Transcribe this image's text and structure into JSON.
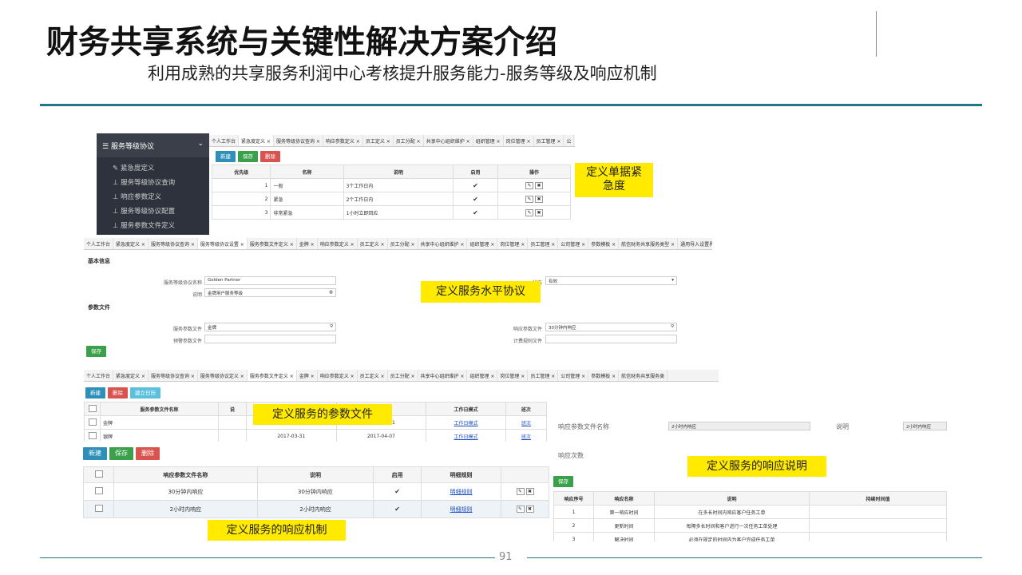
{
  "slide": {
    "title": "财务共享系统与关键性解决方案介绍",
    "subtitle": "利用成熟的共享服务利润中心考核提升服务能力-服务等级及响应机制",
    "page": "91"
  },
  "callouts": {
    "c1": "定义单据紧\n急度",
    "c2": "定义服务水平协议",
    "c3": "定义服务的参数文件",
    "c4": "定义服务的响应说明",
    "c5": "定义服务的响应机制"
  },
  "sidebar": {
    "header": "服务等级协议",
    "items": [
      "紧急度定义",
      "服务等级协议查询",
      "响应参数定义",
      "服务等级协议配置",
      "服务参数文件定义"
    ]
  },
  "shot1": {
    "tabs": [
      "个人工作台",
      "紧急度定义 ×",
      "服务等级协议查询 ×",
      "响应参数定义 ×",
      "员工定义 ×",
      "员工分配 ×",
      "共享中心组织维护 ×",
      "组织管理 ×",
      "岗位管理 ×",
      "员工管理 ×",
      "公"
    ],
    "buttons": {
      "new": "新建",
      "save": "保存",
      "del": "删除"
    },
    "headers": [
      "优先级",
      "名称",
      "说明",
      "启用",
      "操作"
    ],
    "rows": [
      {
        "p": "1",
        "n": "一般",
        "d": "3个工作日内"
      },
      {
        "p": "2",
        "n": "紧急",
        "d": "2个工作日内"
      },
      {
        "p": "3",
        "n": "非常紧急",
        "d": "1小时立即回应"
      }
    ]
  },
  "shot2": {
    "tabs": [
      "个人工作台",
      "紧急度定义 ×",
      "服务等级协议查询 ×",
      "服务等级协议设置 ×",
      "服务参数文件定义 ×",
      "金牌 ×",
      "响应参数定义 ×",
      "员工定义 ×",
      "员工分配 ×",
      "共享中心组织维护 ×",
      "组织管理 ×",
      "岗位管理 ×",
      "员工管理 ×",
      "公司管理 ×",
      "参数模板 ×",
      "航信财务共享服务类型 ×",
      "通用导入设置界面 ×"
    ],
    "basic": "基本信息",
    "name_label": "服务等级协议名称",
    "name_val": "Golden Partner",
    "state_label": "状态",
    "state_val": "有效",
    "desc_label": "说明",
    "desc_val": "金牌用户服务等级",
    "param_sec": "参数文件",
    "svc_label": "服务参数文件",
    "svc_val": "金牌",
    "resp_label": "响应参数文件",
    "resp_val": "30分钟内响应",
    "warn_label": "预警参数文件",
    "bill_label": "计费规则文件",
    "save": "保存"
  },
  "shot3": {
    "tabs": [
      "个人工作台",
      "紧急度定义 ×",
      "服务等级协议查询 ×",
      "服务等级协议定义 ×",
      "服务参数文件定义 ×",
      "金牌 ×",
      "响应参数定义 ×",
      "员工定义 ×",
      "员工分配 ×",
      "共享中心组织维护 ×",
      "组织管理 ×",
      "岗位管理 ×",
      "员工管理 ×",
      "公司管理 ×",
      "参数模板 ×",
      "航信财务共享服务类"
    ],
    "buttons": {
      "new": "新建",
      "del": "删除",
      "cal": "建立日历"
    },
    "headers": [
      "服务参数文件名称",
      "说",
      "日期",
      "",
      "工作日模式",
      "班次"
    ],
    "rows": [
      {
        "n": "金牌",
        "d1": "2017-03-01",
        "d2": "2017-03-31",
        "m": "工作日模式",
        "s": "班次"
      },
      {
        "n": "银牌",
        "d1": "2017-03-31",
        "d2": "2017-04-07",
        "m": "工作日模式",
        "s": "班次"
      }
    ]
  },
  "shot4": {
    "buttons": {
      "new": "新建",
      "save": "保存",
      "del": "删除"
    },
    "headers": [
      "响应参数文件名称",
      "说明",
      "启用",
      "明细规则"
    ],
    "rows": [
      {
        "n": "30分钟内响应",
        "d": "30分钟内响应",
        "r": "明细规则"
      },
      {
        "n": "2小时内响应",
        "d": "2小时内响应",
        "r": "明细规则"
      }
    ]
  },
  "shot5": {
    "name_label": "响应参数文件名称",
    "name_val": "2小时内响应",
    "desc_label": "说明",
    "desc_val": "2小时内响应",
    "count_label": "响应次数",
    "save": "保存",
    "headers": [
      "响应序号",
      "响应名称",
      "说明",
      "持续时间值"
    ],
    "rows": [
      {
        "i": "1",
        "n": "第一响应时间",
        "d": "在多长时间内响应客户任务工单"
      },
      {
        "i": "2",
        "n": "更新时间",
        "d": "每隔多长时间和客户进行一次任务工单处理"
      },
      {
        "i": "3",
        "n": "解决时间",
        "d": "必须在规定的时间内为客户完成任务工单"
      }
    ]
  }
}
